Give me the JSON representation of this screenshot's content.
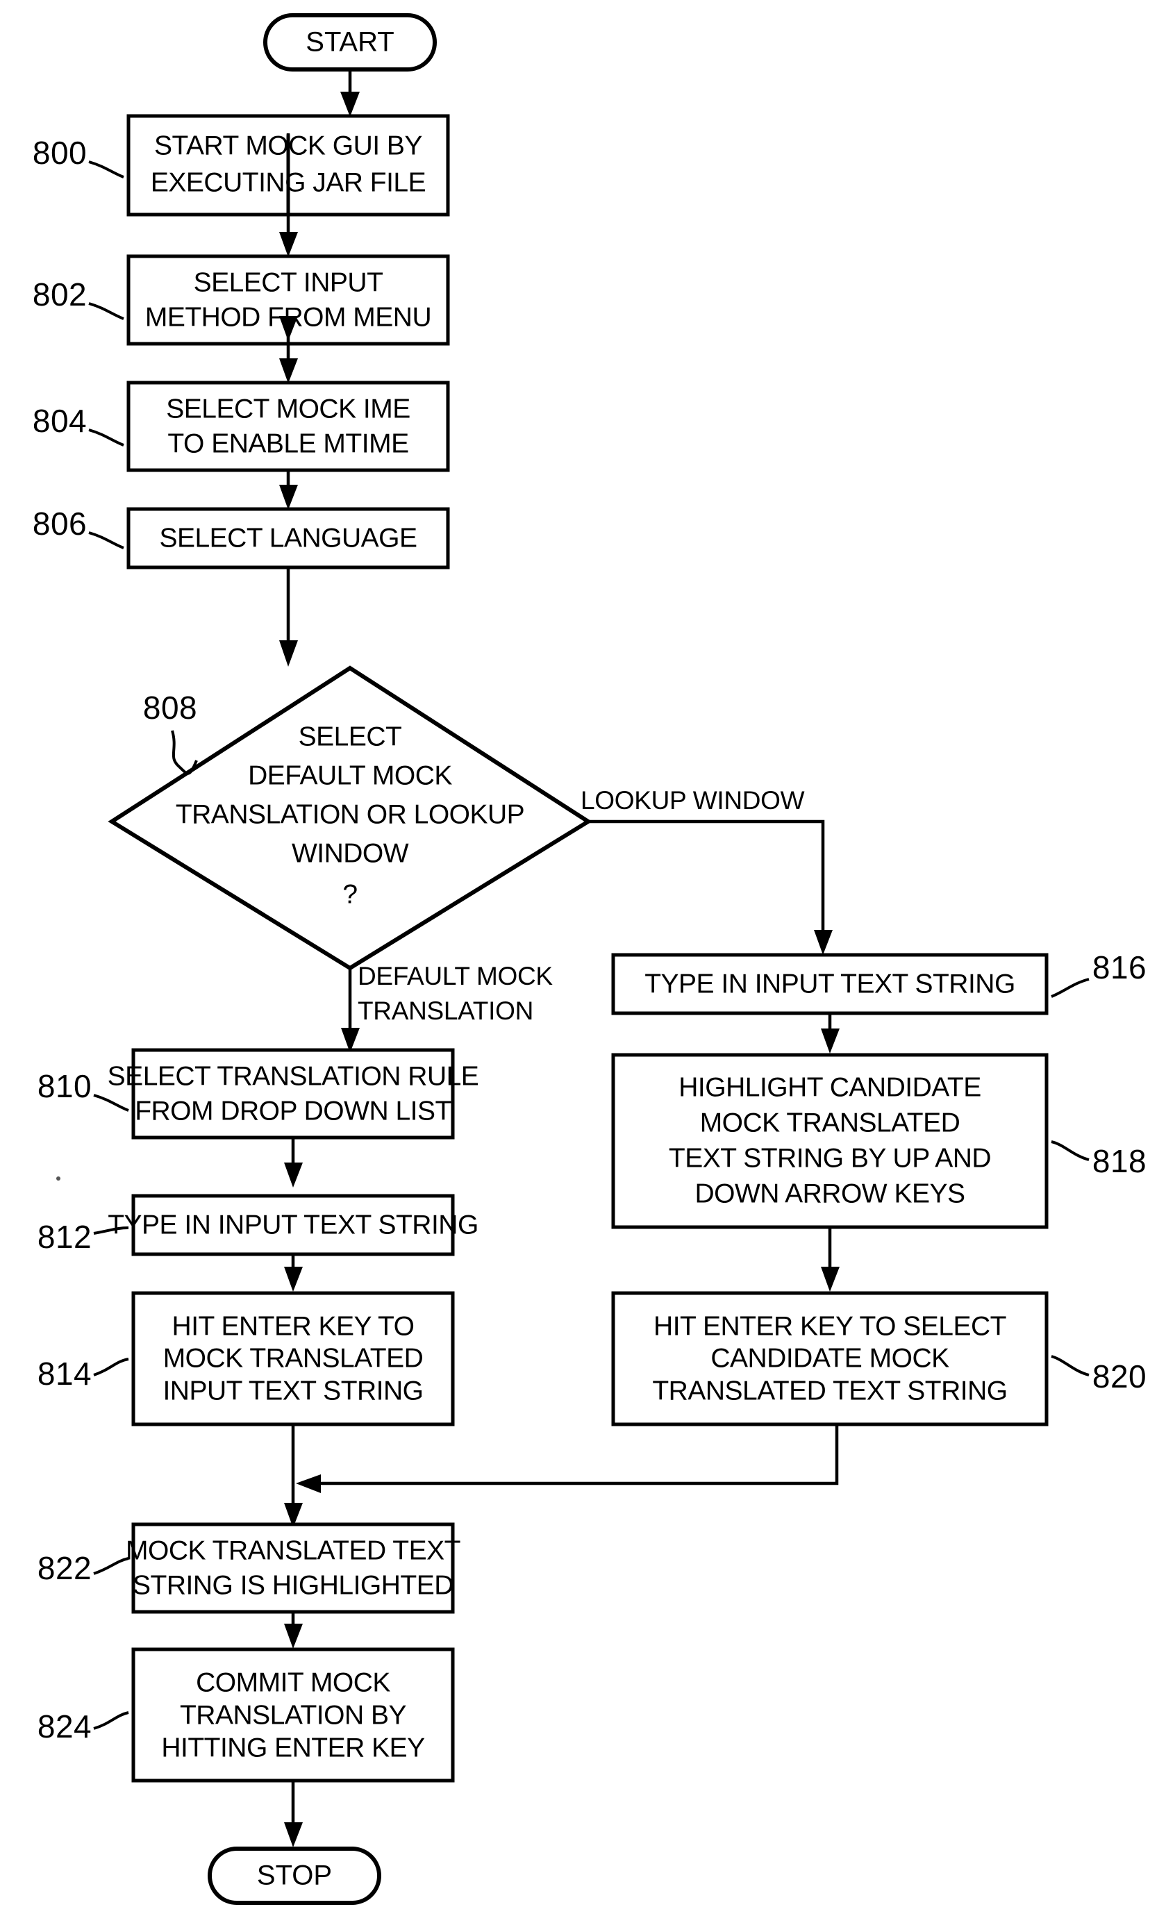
{
  "figure": {
    "type": "flowchart",
    "orientation": "vertical",
    "ink_color": "#000000",
    "background_color": "#ffffff"
  },
  "terminals": {
    "start": "START",
    "stop": "STOP"
  },
  "nodes": [
    {
      "ref": "800",
      "shape": "process",
      "lines": [
        "START MOCK GUI BY",
        "EXECUTING JAR FILE"
      ]
    },
    {
      "ref": "802",
      "shape": "process",
      "lines": [
        "SELECT INPUT",
        "METHOD FROM MENU"
      ]
    },
    {
      "ref": "804",
      "shape": "process",
      "lines": [
        "SELECT MOCK IME",
        "TO ENABLE MTIME"
      ]
    },
    {
      "ref": "806",
      "shape": "process",
      "lines": [
        "SELECT LANGUAGE"
      ]
    },
    {
      "ref": "808",
      "shape": "decision",
      "lines": [
        "SELECT",
        "DEFAULT MOCK",
        "TRANSLATION OR LOOKUP",
        "WINDOW",
        "?"
      ]
    },
    {
      "ref": "810",
      "shape": "process",
      "lines": [
        "SELECT TRANSLATION RULE",
        "FROM DROP DOWN LIST"
      ]
    },
    {
      "ref": "812",
      "shape": "process",
      "lines": [
        "TYPE IN INPUT TEXT STRING"
      ]
    },
    {
      "ref": "814",
      "shape": "process",
      "lines": [
        "HIT ENTER KEY TO",
        "MOCK TRANSLATED",
        "INPUT TEXT STRING"
      ]
    },
    {
      "ref": "816",
      "shape": "process",
      "lines": [
        "TYPE IN INPUT TEXT STRING"
      ]
    },
    {
      "ref": "818",
      "shape": "process",
      "lines": [
        "HIGHLIGHT CANDIDATE",
        "MOCK TRANSLATED",
        "TEXT STRING BY UP AND",
        "DOWN ARROW KEYS"
      ]
    },
    {
      "ref": "820",
      "shape": "process",
      "lines": [
        "HIT ENTER KEY TO SELECT",
        "CANDIDATE MOCK",
        "TRANSLATED TEXT STRING"
      ]
    },
    {
      "ref": "822",
      "shape": "process",
      "lines": [
        "MOCK TRANSLATED TEXT",
        "STRING IS HIGHLIGHTED"
      ]
    },
    {
      "ref": "824",
      "shape": "process",
      "lines": [
        "COMMIT MOCK",
        "TRANSLATION BY",
        "HITTING ENTER KEY"
      ]
    }
  ],
  "edge_labels": {
    "lookup_window": "LOOKUP WINDOW",
    "default_mock_translation_line1": "DEFAULT MOCK",
    "default_mock_translation_line2": "TRANSLATION"
  }
}
